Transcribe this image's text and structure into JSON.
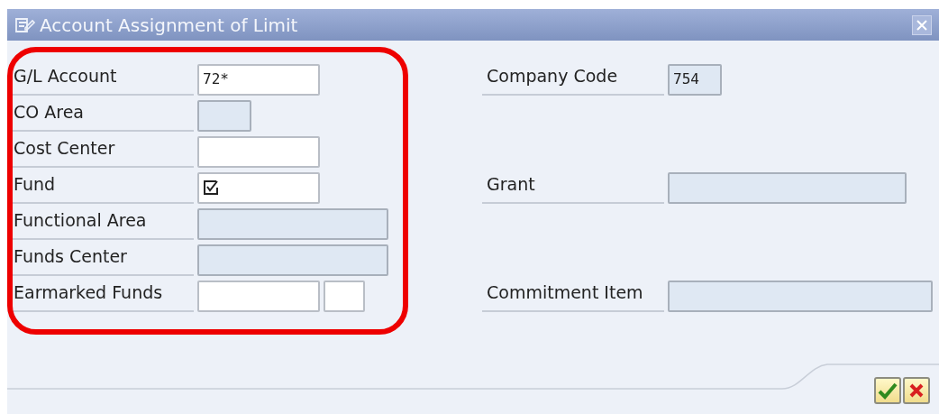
{
  "window": {
    "title": "Account Assignment of Limit"
  },
  "rows": [
    {
      "left": {
        "label": "G/L Account",
        "inputs": [
          {
            "value": "72*",
            "disabled": false
          }
        ]
      },
      "right": {
        "label": "Company Code",
        "inputs": [
          {
            "value": "754",
            "disabled": true
          }
        ]
      }
    },
    {
      "left": {
        "label": "CO Area",
        "inputs": [
          {
            "disabled": true
          }
        ]
      }
    },
    {
      "left": {
        "label": "Cost Center",
        "inputs": [
          {
            "disabled": false
          }
        ]
      }
    },
    {
      "left": {
        "label": "Fund",
        "inputs": [
          {
            "disabled": false,
            "required": true
          }
        ]
      },
      "right": {
        "label": "Grant",
        "inputs": [
          {
            "disabled": true
          }
        ]
      }
    },
    {
      "left": {
        "label": "Functional Area",
        "inputs": [
          {
            "disabled": true
          }
        ]
      }
    },
    {
      "left": {
        "label": "Funds Center",
        "inputs": [
          {
            "disabled": true
          }
        ]
      }
    },
    {
      "left": {
        "label": "Earmarked Funds",
        "inputs": [
          {
            "disabled": false
          },
          {
            "disabled": false
          }
        ]
      },
      "right": {
        "label": "Commitment Item",
        "inputs": [
          {
            "disabled": true
          }
        ]
      }
    }
  ],
  "highlight": {
    "on": true
  },
  "buttons": [
    {
      "kind": "confirm"
    },
    {
      "kind": "cancel"
    }
  ]
}
